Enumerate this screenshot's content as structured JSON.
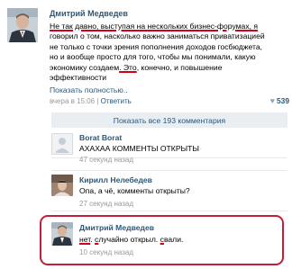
{
  "post": {
    "author": "Дмитрий Медведев",
    "lines": [
      "Не так давно, выступая на нескольких бизнес-форумах, я",
      "говорил о том, насколько важно заниматься приватизацией",
      "не только с точки зрения пополнения доходов госбюджета,",
      "но и вообще просто для того, чтобы мы понимали, какую"
    ],
    "line5_start": "экономику создаем",
    "line5_marked": ". Это",
    "line5_end": ", конечно, и повышение",
    "line6": "эффективности",
    "show_full": "Показать полностью..",
    "time": "вчера в 15:06",
    "reply": "Ответить",
    "likes": "539"
  },
  "show_all_comments": "Показать все 193 комментария",
  "comments": [
    {
      "author": "Borat Borat",
      "text": "АХАХАА КОММЕНТЫ ОТКРЫТЫ",
      "time": "47 секунд назад"
    },
    {
      "author": "Кирилл Нелебедев",
      "text": "Опа, а чё, комменты открыты?",
      "time": "27 секунд назад"
    },
    {
      "author": "Дмитрий Медведев",
      "text_parts": [
        "нет",
        ". ",
        "с",
        "лучайно открыл",
        ". ",
        "с",
        "вали."
      ],
      "time": "10 секунд назад"
    }
  ],
  "colors": {
    "link": "#2b587a",
    "meta": "#999999",
    "highlight": "#c0203a",
    "show_all_bg": "#e9eef3"
  }
}
